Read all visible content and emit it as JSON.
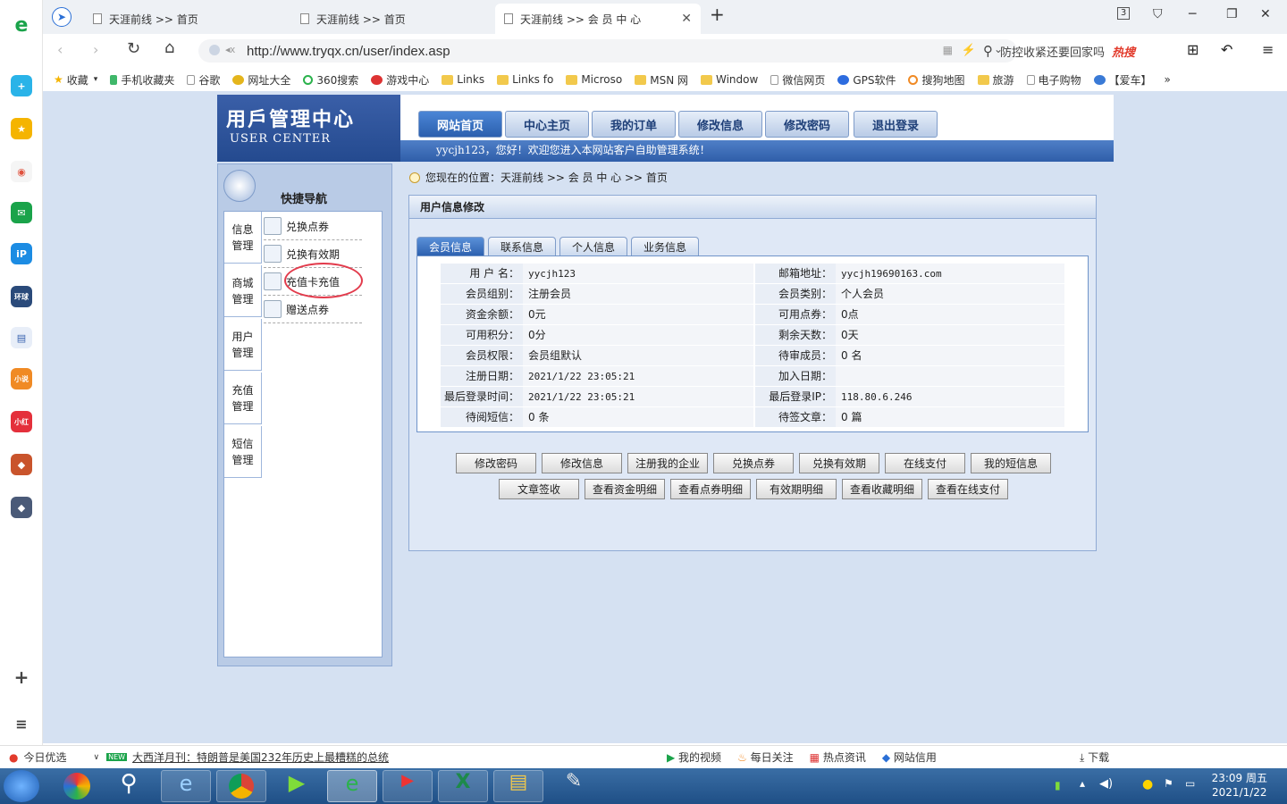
{
  "browser": {
    "tabs": [
      {
        "label": "天涯前线 >> 首页"
      },
      {
        "label": "天涯前线 >> 首页"
      },
      {
        "label": "天涯前线 >> 会 员 中 心"
      }
    ],
    "tab_count": "3",
    "url": "http://www.tryqx.cn/user/index.asp",
    "search_text": "防控收紧还要回家吗",
    "search_hot": "热搜",
    "bookmarks": [
      "收藏",
      "手机收藏夹",
      "谷歌",
      "网址大全",
      "360搜索",
      "游戏中心",
      "Links",
      "Links fo",
      "Microso",
      "MSN 网",
      "Window",
      "微信网页",
      "GPS软件",
      "搜狗地图",
      "旅游",
      "电子购物",
      "【爱车】",
      "»"
    ]
  },
  "header": {
    "logo_cn": "用戶管理中心",
    "logo_en": "USER CENTER",
    "nav": [
      "网站首页",
      "中心主页",
      "我的订单",
      "修改信息",
      "修改密码",
      "退出登录"
    ],
    "welcome": "yycjh123，您好！欢迎您进入本网站客户自助管理系统！"
  },
  "sidebar": {
    "title": "快捷导航",
    "categories": [
      "信息\n管理",
      "商城\n管理",
      "用户\n管理",
      "充值\n管理",
      "短信\n管理"
    ],
    "items": [
      "兑换点券",
      "兑换有效期",
      "充值卡充值",
      "赠送点券"
    ]
  },
  "breadcrumb": "您现在的位置：天涯前线 >> 会 员 中 心 >> 首页",
  "panel": {
    "title": "用户信息修改",
    "tabs": [
      "会员信息",
      "联系信息",
      "个人信息",
      "业务信息"
    ],
    "rows": [
      {
        "l1": "用 户 名：",
        "v1": "yycjh123",
        "l2": "邮箱地址：",
        "v2": "yycjh19690163.com"
      },
      {
        "l1": "会员组别：",
        "v1": "注册会员",
        "l2": "会员类别：",
        "v2": "个人会员"
      },
      {
        "l1": "资金余额：",
        "v1": "0元",
        "l2": "可用点券：",
        "v2": "0点"
      },
      {
        "l1": "可用积分：",
        "v1": "0分",
        "l2": "剩余天数：",
        "v2": "0天"
      },
      {
        "l1": "会员权限：",
        "v1": "会员组默认",
        "l2": "待审成员：",
        "v2": "0 名"
      },
      {
        "l1": "注册日期：",
        "v1": "2021/1/22 23:05:21",
        "l2": "加入日期：",
        "v2": ""
      },
      {
        "l1": "最后登录时间：",
        "v1": "2021/1/22 23:05:21",
        "l2": "最后登录IP：",
        "v2": "118.80.6.246"
      },
      {
        "l1": "待阅短信：",
        "v1": "0 条",
        "l2": "待签文章：",
        "v2": "0 篇"
      }
    ],
    "buttons_row1": [
      "修改密码",
      "修改信息",
      "注册我的企业",
      "兑换点券",
      "兑换有效期",
      "在线支付",
      "我的短信息"
    ],
    "buttons_row2": [
      "文章签收",
      "查看资金明细",
      "查看点券明细",
      "有效期明细",
      "查看收藏明细",
      "查看在线支付"
    ]
  },
  "infobar": {
    "left": "今日优选",
    "news_badge": "NEW",
    "news": "大西洋月刊：特朗普是美国232年历史上最糟糕的总统",
    "items": [
      "我的视频",
      "每日关注",
      "热点资讯",
      "网站信用"
    ],
    "download": "下载"
  },
  "clock": {
    "time": "23:09 周五",
    "date": "2021/1/22"
  }
}
